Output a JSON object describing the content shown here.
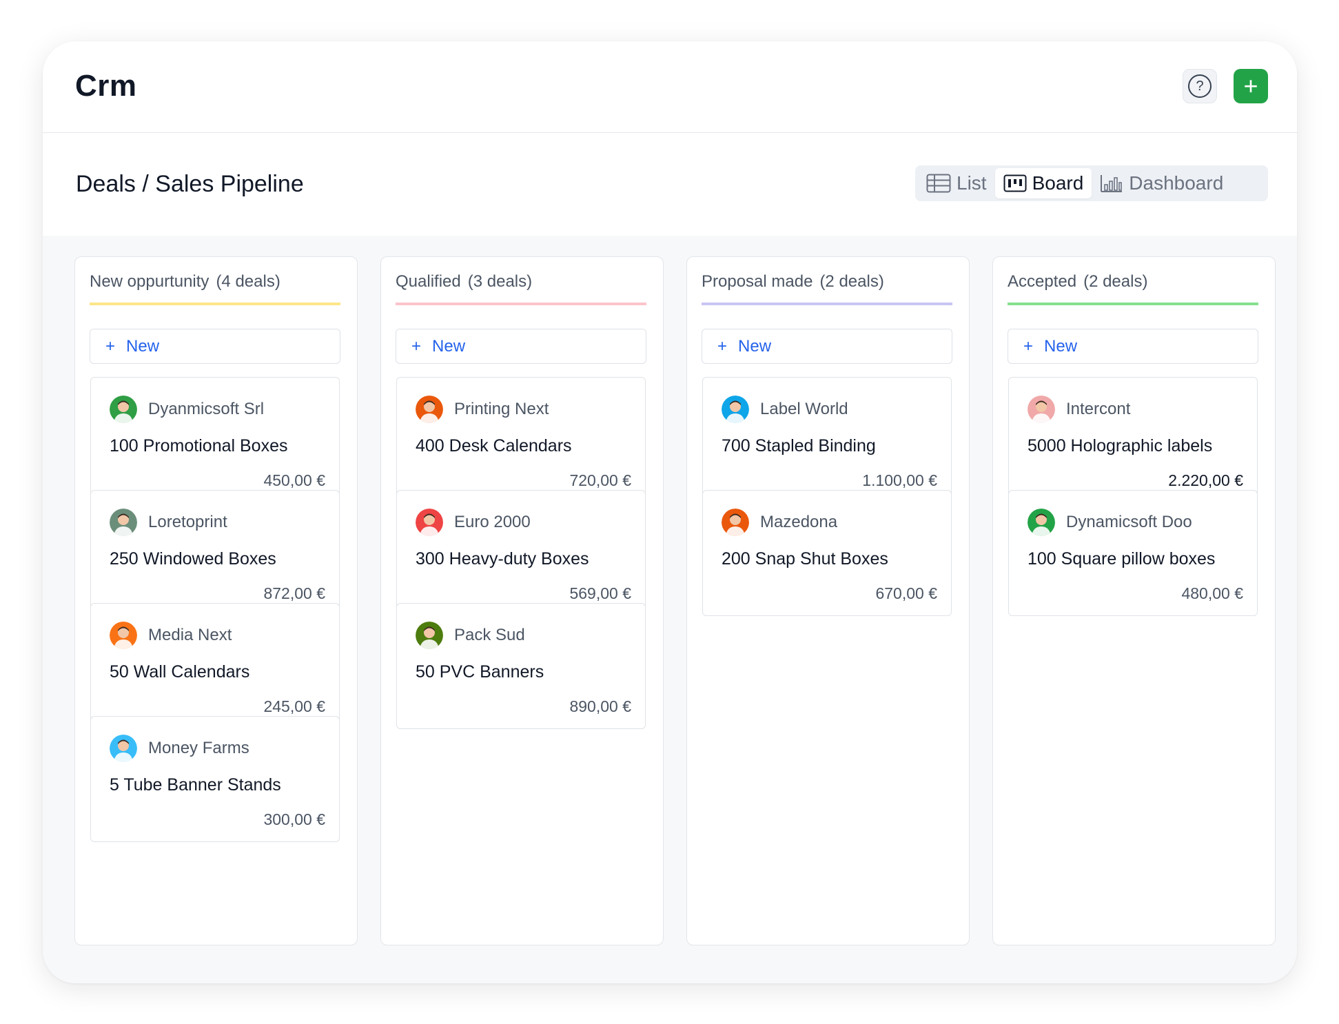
{
  "app": {
    "title": "Crm"
  },
  "header": {
    "help_icon": "question-circle-icon",
    "add_icon": "plus-icon",
    "accent": "#22a347"
  },
  "page": {
    "breadcrumb": "Deals / Sales Pipeline"
  },
  "views": {
    "list": "List",
    "board": "Board",
    "dashboard": "Dashboard",
    "active": "board"
  },
  "new_label": "New",
  "columns": [
    {
      "title": "New oppurtunity",
      "count": "(4 deals)",
      "color": "#fde68a",
      "cards": [
        {
          "company": "Dyanmicsoft Srl",
          "deal": "100 Promotional Boxes",
          "amount": "450,00 €",
          "avatar": "#2f9e44"
        },
        {
          "company": "Loretoprint",
          "deal": "250 Windowed Boxes",
          "amount": "872,00 €",
          "avatar": "#6b8e7a"
        },
        {
          "company": "Media Next",
          "deal": "50 Wall Calendars",
          "amount": "245,00 €",
          "avatar": "#f97316"
        },
        {
          "company": "Money Farms",
          "deal": "5 Tube Banner Stands",
          "amount": "300,00 €",
          "avatar": "#38bdf8"
        }
      ]
    },
    {
      "title": "Qualified",
      "count": "(3 deals)",
      "color": "#fbc4cb",
      "cards": [
        {
          "company": "Printing Next",
          "deal": "400 Desk Calendars",
          "amount": "720,00 €",
          "avatar": "#ea580c"
        },
        {
          "company": "Euro 2000",
          "deal": "300 Heavy-duty Boxes",
          "amount": "569,00 €",
          "avatar": "#ef4444"
        },
        {
          "company": "Pack Sud",
          "deal": "50 PVC Banners",
          "amount": "890,00 €",
          "avatar": "#4d7c0f"
        }
      ]
    },
    {
      "title": "Proposal made",
      "count": "(2 deals)",
      "color": "#c9c6f2",
      "cards": [
        {
          "company": "Label World",
          "deal": "700 Stapled Binding",
          "amount": "1.100,00 €",
          "avatar": "#0ea5e9"
        },
        {
          "company": "Mazedona",
          "deal": "200 Snap Shut Boxes",
          "amount": "670,00 €",
          "avatar": "#ea580c"
        }
      ]
    },
    {
      "title": "Accepted",
      "count": "(2 deals)",
      "color": "#86e08f",
      "cards": [
        {
          "company": "Intercont",
          "deal": "5000 Holographic labels",
          "amount": "2.220,00 €",
          "avatar": "#f0a8a8"
        },
        {
          "company": "Dynamicsoft Doo",
          "deal": "100 Square pillow boxes",
          "amount": "480,00 €",
          "avatar": "#22a347"
        }
      ]
    }
  ]
}
